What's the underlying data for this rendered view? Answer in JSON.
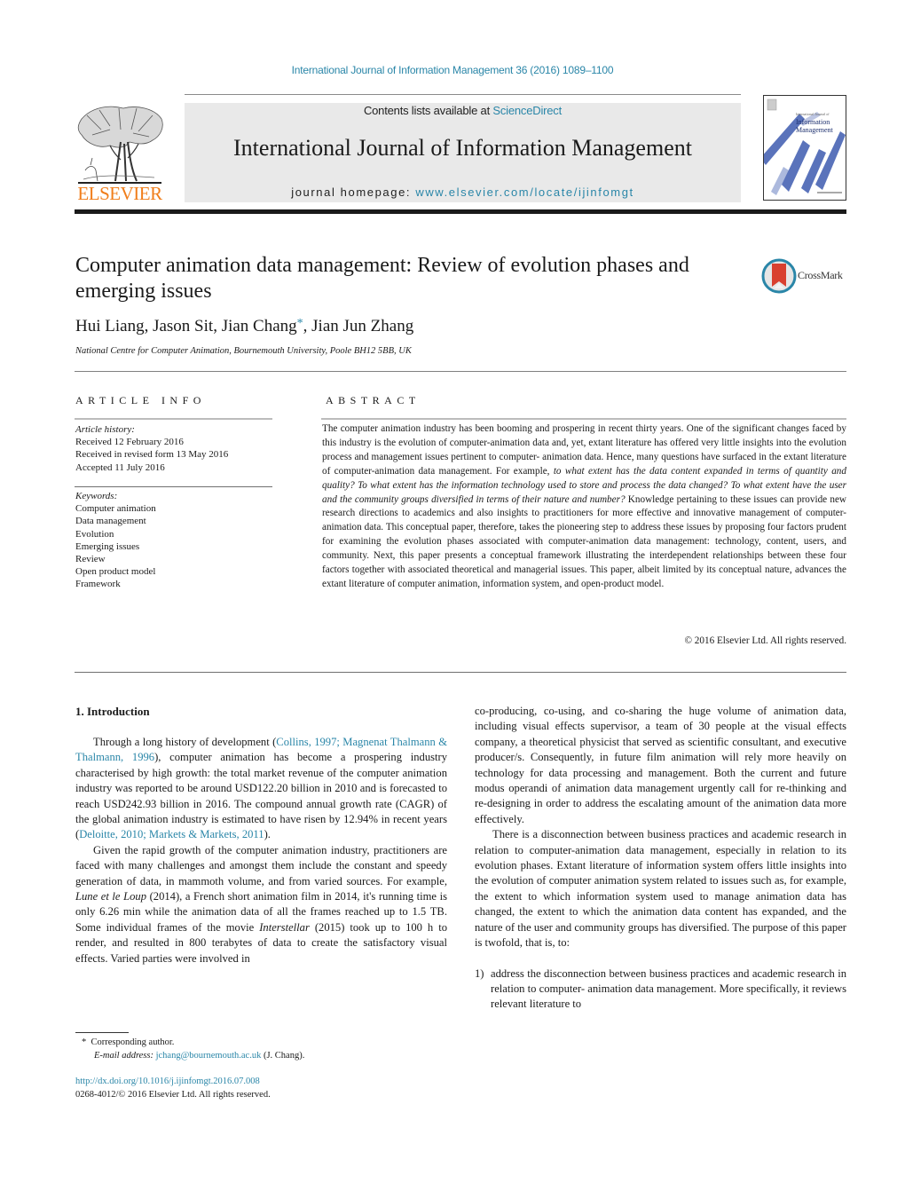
{
  "header": {
    "journal_ref": "International Journal of Information Management 36 (2016) 1089–1100",
    "contents_prefix": "Contents lists available at ",
    "contents_link": "ScienceDirect",
    "journal_title": "International Journal of Information Management",
    "homepage_prefix": "journal homepage: ",
    "homepage_link": "www.elsevier.com/locate/ijinfomgt",
    "publisher_logo_text": "ELSEVIER",
    "cover": {
      "small_line": "International Journal of",
      "line1": "Information",
      "line2": "Management"
    },
    "colors": {
      "link": "#2a86a8",
      "elsevier_orange": "#f07d1a",
      "banner_bg": "#e9e9e9",
      "cover_blue": "#2c4aa0",
      "crossmark_red": "#d9402f"
    }
  },
  "article": {
    "title": "Computer animation data management: Review of evolution phases and emerging issues",
    "crossmark_label": "CrossMark",
    "authors": [
      {
        "name": "Hui Liang",
        "sep": ", "
      },
      {
        "name": "Jason Sit",
        "sep": ", "
      },
      {
        "name": "Jian Chang",
        "mark": "*",
        "sep": ", "
      },
      {
        "name": "Jian Jun Zhang",
        "sep": ""
      }
    ],
    "affiliation": "National Centre for Computer Animation, Bournemouth University, Poole BH12 5BB, UK"
  },
  "article_info": {
    "heading": "ARTICLE INFO",
    "history_label": "Article history:",
    "history": [
      "Received 12 February 2016",
      "Received in revised form 13 May 2016",
      "Accepted 11 July 2016"
    ],
    "keywords_label": "Keywords:",
    "keywords": [
      "Computer animation",
      "Data management",
      "Evolution",
      "Emerging issues",
      "Review",
      "Open product model",
      "Framework"
    ]
  },
  "abstract": {
    "heading": "ABSTRACT",
    "part1": "The computer animation industry has been booming and prospering in recent thirty years. One of the significant changes faced by this industry is the evolution of computer-animation data and, yet, extant literature has offered very little insights into the evolution process and management issues pertinent to computer- animation data. Hence, many questions have surfaced in the extant literature of computer-animation data management. For example, ",
    "italic": "to what extent has the data content expanded in terms of quantity and quality? To what extent has the information technology used to store and process the data changed? To what extent have the user and the community groups diversified in terms of their nature and number?",
    "part2": " Knowledge pertaining to these issues can provide new research directions to academics and also insights to practitioners for more effective and innovative management of computer- animation data. This conceptual paper, therefore, takes the pioneering step to address these issues by proposing four factors prudent for examining the evolution phases associated with computer-animation data management: technology, content, users, and community. Next, this paper presents a conceptual framework illustrating the interdependent relationships between these four factors together with associated theoretical and managerial issues. This paper, albeit limited by its conceptual nature, advances the extant literature of computer animation, information system, and open-product model.",
    "copyright": "© 2016 Elsevier Ltd. All rights reserved."
  },
  "body": {
    "section_heading": "1.  Introduction",
    "p1_a": "Through a long history of development (",
    "p1_ref1": "Collins, 1997; Magnenat Thalmann & Thalmann, 1996",
    "p1_b": "), computer animation has become a prospering industry characterised by high growth: the total market revenue of the computer animation industry was reported to be around USD122.20 billion in 2010 and is forecasted to reach USD242.93 billion in 2016. The compound annual growth rate (CAGR) of the global animation industry is estimated to have risen by 12.94% in recent years (",
    "p1_ref2": "Deloitte, 2010; Markets & Markets, 2011",
    "p1_c": ").",
    "p2_a": "Given the rapid growth of the computer animation industry, practitioners are faced with many challenges and amongst them include the constant and speedy generation of data, in mammoth volume, and from varied sources. For example, ",
    "p2_film1": "Lune et le Loup",
    "p2_b": " (2014), a French short animation film in 2014, it's running time is only 6.26 min while the animation data of all the frames reached up to 1.5 TB. Some individual frames of the movie ",
    "p2_film2": "Interstellar",
    "p2_c": " (2015) took up to 100 h to render, and resulted in 800 terabytes of data to create the satisfactory visual effects. Varied parties were involved in",
    "p2_cont": "co-producing, co-using, and co-sharing the huge volume of animation data, including visual effects supervisor, a team of 30 people at the visual effects company, a theoretical physicist that served as scientific consultant, and executive producer/s. Consequently, in future film animation will rely more heavily on technology for data processing and management. Both the current and future modus operandi of animation data management urgently call for re-thinking and re-designing in order to address the escalating amount of the animation data more effectively.",
    "p3": "There is a disconnection between business practices and academic research in relation to computer-animation data management, especially in relation to its evolution phases. Extant literature of information system offers little insights into the evolution of computer animation system related to issues such as, for example, the extent to which information system used to manage animation data has changed, the extent to which the animation data content has expanded, and the nature of the user and community groups has diversified. The purpose of this paper is twofold, that is, to:",
    "list": [
      {
        "num": "1)",
        "text": "address the disconnection between business practices and academic research in relation to computer- animation data management. More specifically, it reviews relevant literature to"
      }
    ]
  },
  "footer": {
    "fn_mark": "*",
    "fn_text": "Corresponding author.",
    "email_label": "E-mail address: ",
    "email": "jchang@bournemouth.ac.uk",
    "email_suffix": " (J. Chang).",
    "doi": "http://dx.doi.org/10.1016/j.ijinfomgt.2016.07.008",
    "issn_line": "0268-4012/© 2016 Elsevier Ltd. All rights reserved."
  }
}
